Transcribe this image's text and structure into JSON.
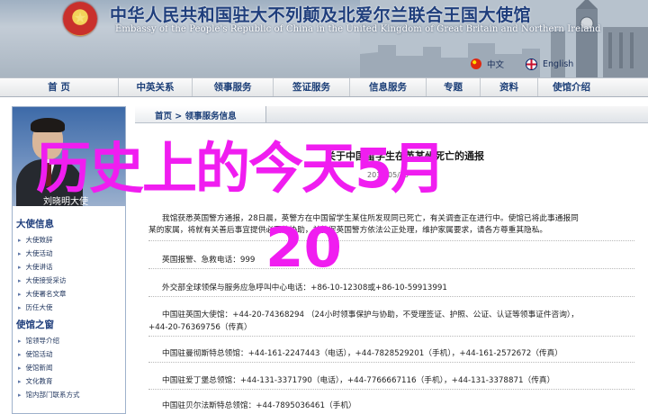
{
  "header": {
    "emblem": "★",
    "title_cn": "中华人民共和国驻大不列颠及北爱尔兰联合王国大使馆",
    "title_en": "Embassy of the People's Republic of China in the United Kingdom of Great Britain and Northern Ireland",
    "lang_cn": "中文",
    "lang_en": "English"
  },
  "nav": {
    "items": [
      "首 页",
      "中英关系",
      "领事服务",
      "签证服务",
      "信息服务",
      "专题",
      "资料",
      "使馆介绍"
    ]
  },
  "sidebar": {
    "photo_caption": "刘晓明大使",
    "ambassador_heading": "大使信息",
    "ambassador_items": [
      "大使致辞",
      "大使活动",
      "大使讲话",
      "大使接受采访",
      "大使署名文章",
      "历任大使"
    ],
    "embassy_heading": "使馆之窗",
    "embassy_items": [
      "馆领导介绍",
      "使馆活动",
      "使馆新闻",
      "文化教育",
      "馆内部门联系方式"
    ]
  },
  "main": {
    "breadcrumb": "首页 > 领事服务信息",
    "notice_title": "关于中国留学生在英某州死亡的通报",
    "notice_date": "2016/05/25",
    "paragraph_1": "我馆获悉英国警方通报，28日晨，英警方在中国留学生某住所发现同已死亡，有关调查正在进行中。使馆已将此事通报同",
    "paragraph_2": "某的家属，将就有关善后事宜提供必要的协助，并敦促英国警方依法公正处理，维护家属要求，请各方尊重其隐私。",
    "police_label": "英国报警、急救电话：",
    "police_number": "999",
    "mfa_hotline": "外交部全球领保与服务应急呼叫中心电话：+86-10-12308或+86-10-59913991",
    "embassy_line_1": "中国驻英国大使馆：+44-20-74368294 （24小时领事保护与协助，不受理签证、护照、公证、认证等领事证件咨询），",
    "embassy_line_2": "+44-20-76369756（传真）",
    "consulates": [
      "中国驻曼彻斯特总领馆：+44-161-2247443（电话），+44-7828529201（手机），+44-161-2572672（传真）",
      "中国驻爱丁堡总领馆：+44-131-3371790（电话），+44-7766667116（手机），+44-131-3378871（传真）",
      "中国驻贝尔法斯特总领馆：+44-7895036461（手机）"
    ]
  },
  "overlay": {
    "title": "历史上的今天5月",
    "number": "20"
  }
}
